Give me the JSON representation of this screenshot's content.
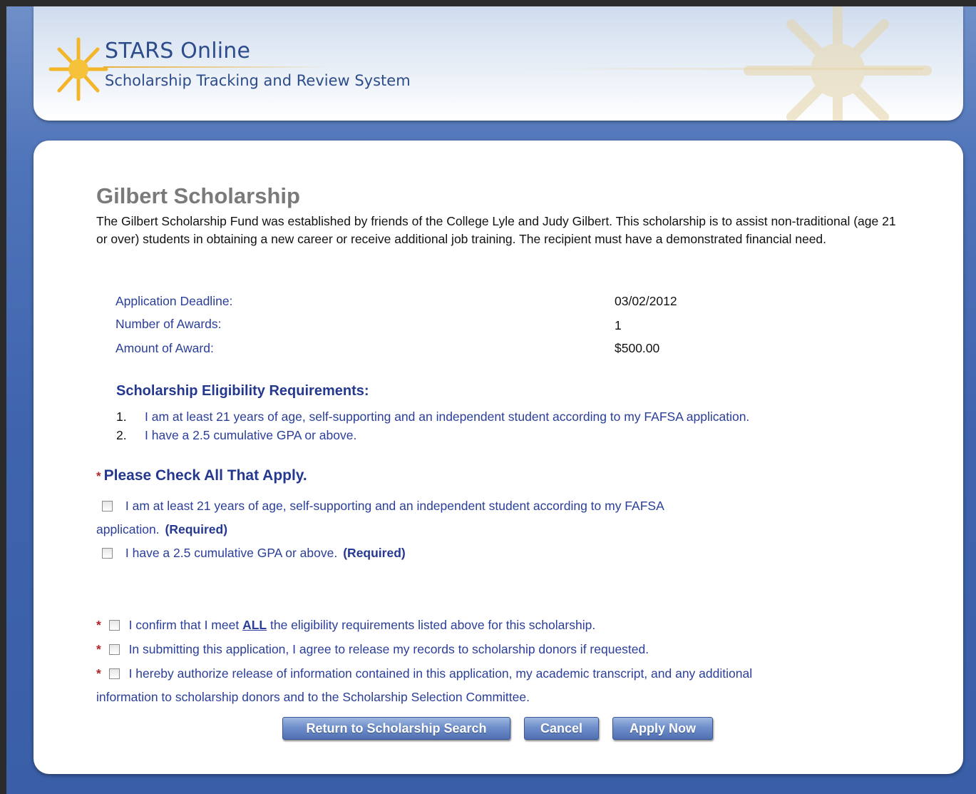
{
  "header": {
    "app_title": "STARS Online",
    "app_subtitle": "Scholarship Tracking and Review System"
  },
  "scholarship": {
    "title": "Gilbert Scholarship",
    "description": "The Gilbert Scholarship Fund was established by friends of the College Lyle and Judy Gilbert. This scholarship is to assist non-traditional (age 21 or over) students in obtaining a new career or receive additional job training. The recipient must have a demonstrated financial need."
  },
  "details": [
    {
      "label": "Application Deadline:",
      "value": "03/02/2012"
    },
    {
      "label": "Number of Awards:",
      "value": "1"
    },
    {
      "label": "Amount of Award:",
      "value": "$500.00"
    }
  ],
  "eligibility": {
    "heading": "Scholarship Eligibility Requirements:",
    "items": [
      {
        "num": "1.",
        "text": "I am at least 21 years of age, self-supporting and an independent student according to my FAFSA application."
      },
      {
        "num": "2.",
        "text": "I have a 2.5 cumulative GPA or above."
      }
    ]
  },
  "check_all": {
    "marker": "*",
    "heading": "Please Check All That Apply.",
    "required_tag": "(Required)",
    "items": [
      {
        "text_line1": "I am at least 21 years of age, self-supporting and an independent student according to my FAFSA",
        "text_line2": "application.",
        "checked": false
      },
      {
        "text": "I have a 2.5 cumulative GPA or above.",
        "checked": false
      }
    ]
  },
  "confirmations": {
    "marker": "*",
    "confirm_pre": "I confirm that I meet",
    "confirm_emph": "ALL",
    "confirm_post": "the eligibility requirements listed above for this scholarship.",
    "release": "In submitting this application, I agree to release my records to scholarship donors if requested.",
    "authorize_line1": "I hereby authorize release of information contained in this application, my academic transcript, and any additional",
    "authorize_line2": "information to scholarship donors and to the Scholarship Selection Committee."
  },
  "buttons": {
    "return": "Return to Scholarship Search",
    "cancel": "Cancel",
    "apply": "Apply Now"
  },
  "colors": {
    "background_blue": "#3f64ad",
    "link_blue": "#2a3e9a",
    "required_star": "#b0262a",
    "logo_sun": "#f3b52a"
  },
  "icons": {
    "logo": "sun-logo-icon",
    "decoration": "sun-decoration-icon"
  }
}
